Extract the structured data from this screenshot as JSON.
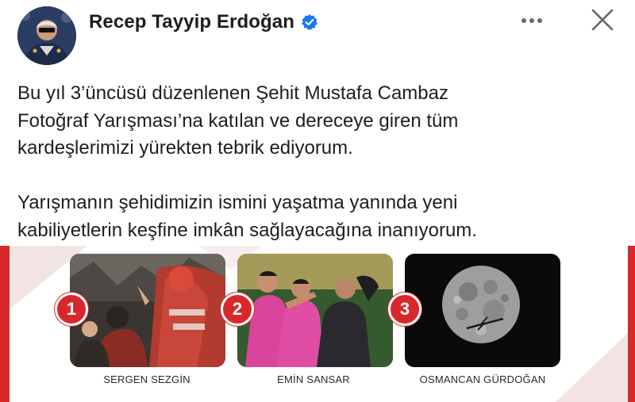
{
  "header": {
    "author": "Recep Tayyip Erdoğan",
    "icons": [
      "avatar",
      "verified-badge-icon",
      "more-options-icon",
      "close-icon"
    ]
  },
  "post": {
    "lines": [
      "Bu yıl 3’üncüsü düzenlenen Şehit Mustafa Cambaz",
      "Fotoğraf Yarışması’na katılan ve dereceye giren tüm",
      "kardeşlerimizi yürekten tebrik ediyorum.",
      "Yarışmanın şehidimizin ismini yaşatma yanında yeni",
      "kabiliyetlerin keşfine imkân sağlayacağına inanıyorum."
    ]
  },
  "banner": {
    "entries": [
      {
        "rank": "1",
        "name": "SERGEN SEZGİN"
      },
      {
        "rank": "2",
        "name": "EMİN SANSAR"
      },
      {
        "rank": "3",
        "name": "OSMANCAN GÜRDOĞAN"
      }
    ],
    "accent_color": "#d8282c"
  },
  "colors": {
    "text": "#1c1e21",
    "verified": "#1877f2",
    "icon_gray": "#65676b"
  }
}
